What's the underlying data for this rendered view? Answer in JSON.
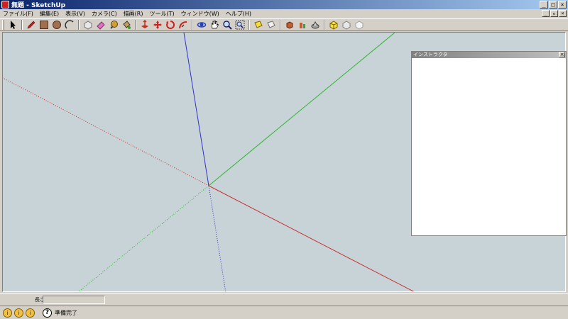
{
  "window": {
    "title": "無題 - SketchUp"
  },
  "menu": [
    "ファイル(F)",
    "編集(E)",
    "表示(V)",
    "カメラ(C)",
    "描画(R)",
    "ツール(T)",
    "ウィンドウ(W)",
    "ヘルプ(H)"
  ],
  "toolbar": {
    "tools": [
      "select-tool",
      "pencil-tool",
      "rectangle-tool",
      "circle-tool",
      "arc-tool",
      "make-component-tool",
      "eraser-tool",
      "tape-measure-tool",
      "paint-bucket-tool",
      "push-pull-tool",
      "move-tool",
      "rotate-tool",
      "follow-me-tool",
      "orbit-tool",
      "pan-tool",
      "zoom-tool",
      "zoom-extents-tool",
      "previous-view-tool",
      "next-view-tool",
      "3d-warehouse-tool",
      "get-models-tool",
      "share-model-tool",
      "iso-view-tool",
      "top-view-tool",
      "front-view-tool"
    ]
  },
  "instructor": {
    "title": "インストラクタ"
  },
  "vcb": {
    "label": "長さ",
    "value": ""
  },
  "status": {
    "text": "準備完了"
  },
  "colors": {
    "axis_red": "#c83232",
    "axis_green": "#32b432",
    "axis_blue": "#3232c8",
    "viewport_bg": "#c7d3d6"
  }
}
